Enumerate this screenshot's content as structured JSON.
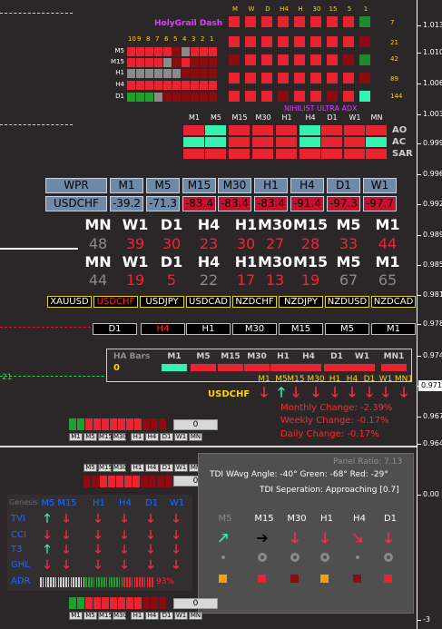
{
  "price_axis": {
    "labels": [
      "1.013",
      "1.010",
      "1.006",
      "1.003",
      "0.999",
      "0.996",
      "0.992",
      "0.989",
      "0.985",
      "0.981",
      "0.978",
      "0.974",
      "0.971",
      "0.967",
      "0.964",
      "0.00",
      "-3"
    ],
    "current_price": "0.971"
  },
  "holygrail": {
    "title": "HolyGrail Dash",
    "tf_headers": [
      "M",
      "W",
      "D",
      "H4",
      "H",
      "30",
      "15",
      "5",
      "1"
    ],
    "side_counts": [
      "7",
      "21",
      "42",
      "89",
      "144"
    ],
    "small_index": [
      "10",
      "9",
      "8",
      "7",
      "6",
      "5",
      "4",
      "3",
      "2",
      "1"
    ],
    "row_labels": [
      "M5",
      "M15",
      "H1",
      "H4",
      "D1"
    ]
  },
  "adx": {
    "title": "NIHILIST ULTRA ADX",
    "tf_headers": [
      "M1",
      "M5",
      "M15",
      "M30",
      "H1",
      "H4",
      "D1",
      "W1",
      "MN"
    ],
    "row_labels": [
      "AO",
      "AC",
      "SAR"
    ]
  },
  "wpr": {
    "label": "WPR",
    "symbol": "USDCHF",
    "tf_headers": [
      "M1",
      "M5",
      "M15",
      "M30",
      "H1",
      "H4",
      "D1",
      "W1"
    ],
    "values": [
      "-39.2",
      "-71.3",
      "-83.4",
      "-83.4",
      "-83.4",
      "-91.4",
      "-97.3",
      "-97.7"
    ]
  },
  "strength_rows": [
    {
      "labels": [
        "MN",
        "W1",
        "D1",
        "H4",
        "H1",
        "M30",
        "M15",
        "M5",
        "M1"
      ],
      "values": [
        "48",
        "39",
        "30",
        "23",
        "30",
        "27",
        "28",
        "33",
        "44"
      ]
    },
    {
      "labels": [
        "MN",
        "W1",
        "D1",
        "H4",
        "H1",
        "M30",
        "M15",
        "M5",
        "M1"
      ],
      "values": [
        "44",
        "19",
        "5",
        "22",
        "17",
        "13",
        "19",
        "67",
        "65"
      ]
    }
  ],
  "pairs": [
    "XAUUSD",
    "USDCHF",
    "USDJPY",
    "USDCAD",
    "NZDCHF",
    "NZDJPY",
    "NZDUSD",
    "NZDCAD"
  ],
  "active_pair": "USDCHF",
  "tf_buttons": [
    "D1",
    "H4",
    "H1",
    "M30",
    "M15",
    "M5",
    "M1"
  ],
  "ha_bars": {
    "title": "HA Bars",
    "count": "0",
    "tf_headers": [
      "M1",
      "M5",
      "M15",
      "M30",
      "H1",
      "H4",
      "D1",
      "W1",
      "MN1"
    ]
  },
  "arrows_strip": {
    "symbol": "USDCHF",
    "tf_headers": [
      "M1",
      "M5",
      "M15",
      "M30",
      "H1",
      "H4",
      "D1",
      "W1",
      "MN1"
    ]
  },
  "changes": {
    "monthly": "Monthly Change: -2.39%",
    "weekly": "Weekly Change: -0.17%",
    "daily": "Daily Change: -0.17%"
  },
  "left_level_label": "21",
  "mini_bar": {
    "count": "0",
    "tfs": [
      "M1",
      "M5",
      "M15",
      "M30",
      "H1",
      "H4",
      "D1",
      "W1",
      "MN"
    ]
  },
  "tdi": {
    "ratio": "Panel Ratio: 7.13",
    "angles": "TDI WAvg Angle: -40°  Green: -68°  Red: -29°",
    "separation": "TDI Seperation: Approaching [0.7]",
    "tf_headers": [
      "M5",
      "M15",
      "M30",
      "H1",
      "H4",
      "D1"
    ]
  },
  "genesis": {
    "title": "Genesis",
    "tf_headers": [
      "M5",
      "M15",
      "H1",
      "H4",
      "D1",
      "W1"
    ],
    "rows": [
      "TVI",
      "CCI",
      "T3",
      "GHL",
      "ADR"
    ],
    "adr_percent": "93%"
  },
  "colors": {
    "up": "#22e28a",
    "down": "#ff1e2e",
    "dark_red": "#8a0b10",
    "grey": "#808080",
    "yellow": "#ffd400",
    "magenta": "#e23cff",
    "blue": "#2a79ff"
  }
}
